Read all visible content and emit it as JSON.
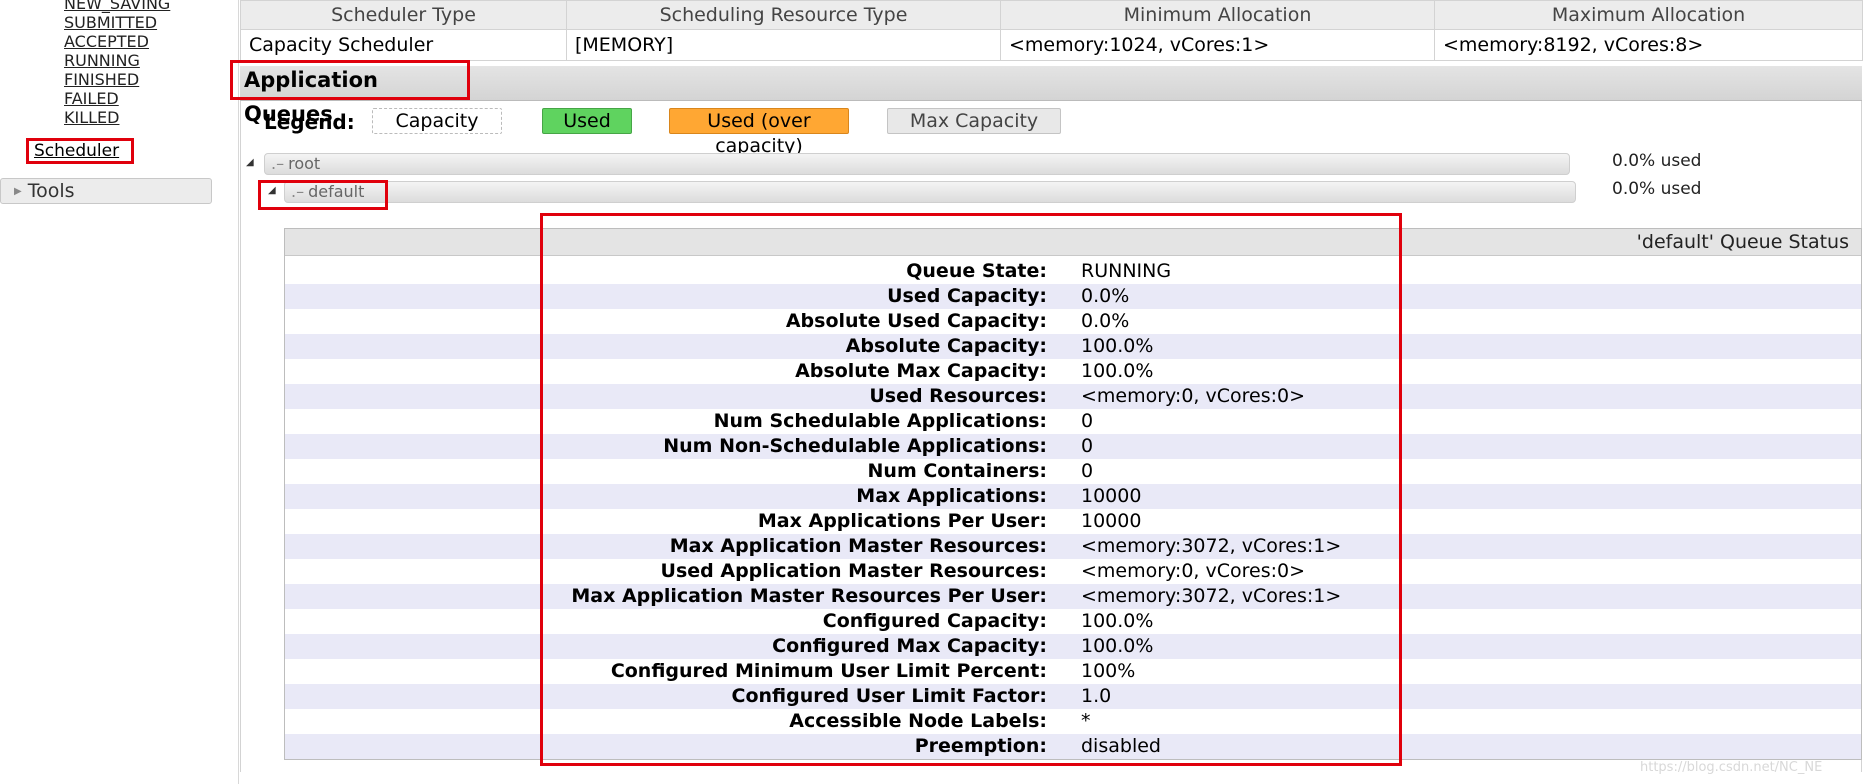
{
  "nav": {
    "app_states": [
      "NEW_SAVING",
      "SUBMITTED",
      "ACCEPTED",
      "RUNNING",
      "FINISHED",
      "FAILED",
      "KILLED"
    ],
    "scheduler_label": "Scheduler",
    "tools_label": "Tools"
  },
  "info_table": {
    "headers": [
      "Scheduler Type",
      "Scheduling Resource Type",
      "Minimum Allocation",
      "Maximum Allocation"
    ],
    "row": [
      "Capacity Scheduler",
      "[MEMORY]",
      "<memory:1024, vCores:1>",
      "<memory:8192, vCores:8>"
    ]
  },
  "queues": {
    "title": "Application Queues",
    "legend_label": "Legend:",
    "legend": {
      "capacity": "Capacity",
      "used": "Used",
      "over": "Used (over capacity)",
      "max": "Max Capacity"
    },
    "colors": {
      "used": "#5fd35f",
      "over": "#ffa733",
      "highlight": "#e0000c"
    },
    "root": {
      "name": "root",
      "used": "0.0% used"
    },
    "default": {
      "name": "default",
      "used": "0.0% used"
    }
  },
  "status": {
    "title": "'default' Queue Status",
    "rows": [
      {
        "k": "Queue State:",
        "v": "RUNNING"
      },
      {
        "k": "Used Capacity:",
        "v": "0.0%"
      },
      {
        "k": "Absolute Used Capacity:",
        "v": "0.0%"
      },
      {
        "k": "Absolute Capacity:",
        "v": "100.0%"
      },
      {
        "k": "Absolute Max Capacity:",
        "v": "100.0%"
      },
      {
        "k": "Used Resources:",
        "v": "<memory:0, vCores:0>"
      },
      {
        "k": "Num Schedulable Applications:",
        "v": "0"
      },
      {
        "k": "Num Non-Schedulable Applications:",
        "v": "0"
      },
      {
        "k": "Num Containers:",
        "v": "0"
      },
      {
        "k": "Max Applications:",
        "v": "10000"
      },
      {
        "k": "Max Applications Per User:",
        "v": "10000"
      },
      {
        "k": "Max Application Master Resources:",
        "v": "<memory:3072, vCores:1>"
      },
      {
        "k": "Used Application Master Resources:",
        "v": "<memory:0, vCores:0>"
      },
      {
        "k": "Max Application Master Resources Per User:",
        "v": "<memory:3072, vCores:1>"
      },
      {
        "k": "Configured Capacity:",
        "v": "100.0%"
      },
      {
        "k": "Configured Max Capacity:",
        "v": "100.0%"
      },
      {
        "k": "Configured Minimum User Limit Percent:",
        "v": "100%"
      },
      {
        "k": "Configured User Limit Factor:",
        "v": "1.0"
      },
      {
        "k": "Accessible Node Labels:",
        "v": "*"
      },
      {
        "k": "Preemption:",
        "v": "disabled"
      }
    ]
  },
  "watermark": "https://blog.csdn.net/NC_NE"
}
